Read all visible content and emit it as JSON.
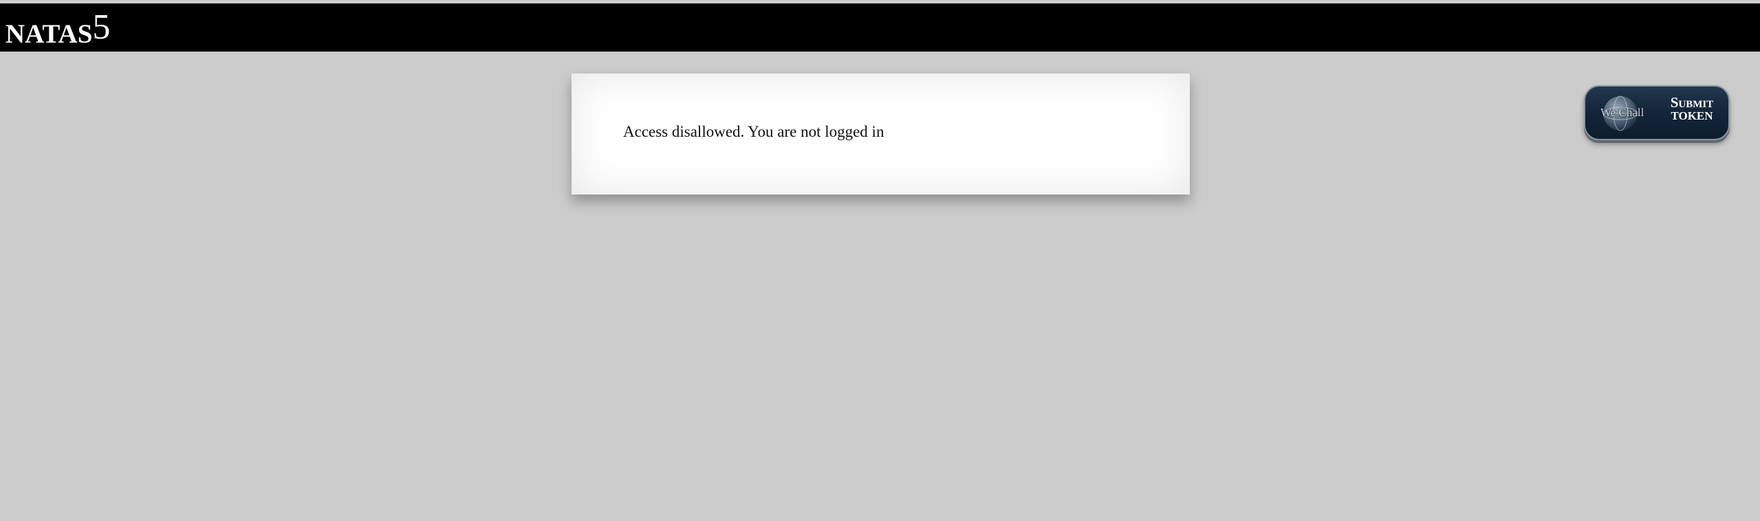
{
  "header": {
    "title_name": "NATAS",
    "title_number": "5"
  },
  "content": {
    "message": "Access disallowed. You are not logged in"
  },
  "submit_token": {
    "logo_text": "We Chall",
    "line1": "Submit",
    "line2": "TOKEN"
  },
  "colors": {
    "background": "#cccccc",
    "header_bar": "#000000",
    "panel": "#ffffff",
    "button": "#14263a"
  }
}
